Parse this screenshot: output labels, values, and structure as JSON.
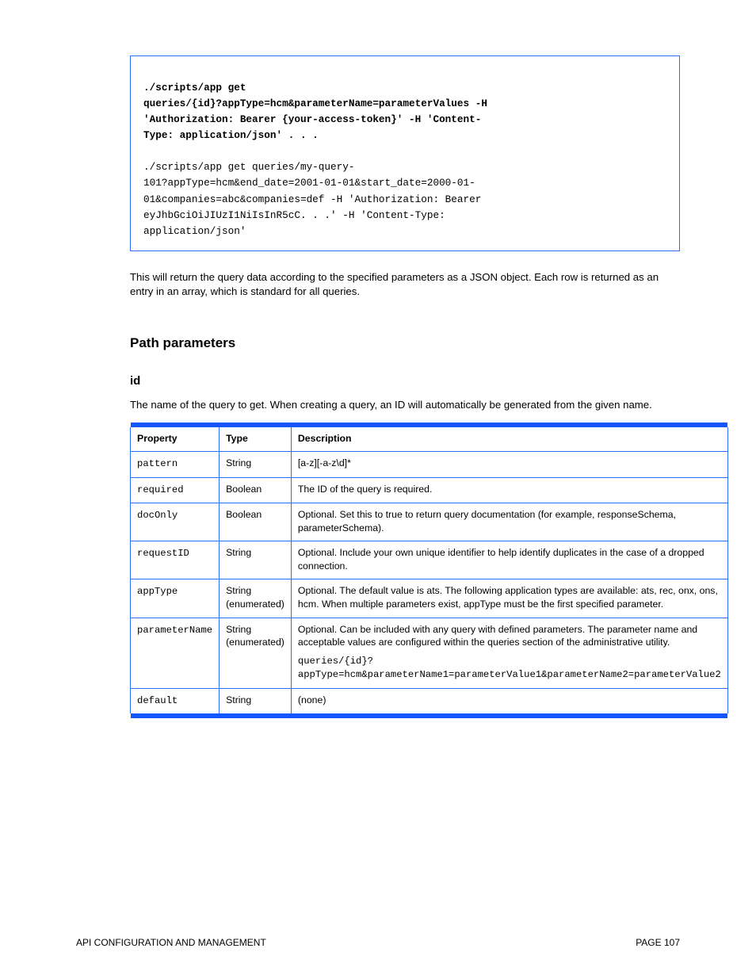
{
  "codebox": {
    "lines": [
      "",
      "./scripts/app get",
      "queries/{id}?appType=hcm&parameterName=parameterValues -H",
      "'Authorization: Bearer {your-access-token}' -H 'Content-",
      "Type: application/json' . . .",
      "",
      "./scripts/app get queries/my-query-",
      "101?appType=hcm&end_date=2001-01-01&start_date=2000-01-",
      "01&companies=abc&companies=def -H 'Authorization: Bearer",
      "eyJhbGciOiJIUzI1NiIsInR5cC. . .' -H 'Content-Type:",
      "application/json'"
    ],
    "bold_until": 4
  },
  "intro": "This will return the query data according to the specified parameters as a JSON object. Each row is returned as an entry in an array, which is standard for all queries.",
  "heading_pathparams": "Path parameters",
  "heading_field_id": "id",
  "field_id_desc": "The name of the query to get. When creating a query, an ID will automatically be generated from the given name.",
  "table": {
    "headers": [
      "Property",
      "Type",
      "Description"
    ],
    "rows": [
      [
        "pattern",
        "String",
        "[a-z][-a-z\\d]*"
      ],
      [
        "required",
        "Boolean",
        "The ID of the query is required."
      ],
      [
        "docOnly",
        "Boolean",
        "Optional. Set this to true to return query documentation (for example, responseSchema, parameterSchema)."
      ],
      [
        "requestID ",
        "String",
        "Optional. Include your own unique identifier to help identify duplicates in the case of a dropped connection."
      ],
      [
        "appType",
        "String (enumerated)",
        "Optional. The default value is ats. The following application types are available: ats, rec, onx, ons, hcm. When multiple parameters exist, appType must be the first specified parameter."
      ],
      [
        "parameterName   ",
        "String (enumerated)",
        "Optional. Can be included with any query with defined parameters. The parameter name and acceptable values are configured within the queries section of the administrative utility.\nqueries/{id}?appType=hcm&parameterName1=parameterValue1&parameterName2=parameterValue2"
      ],
      [
        "default",
        "String",
        "(none)"
      ]
    ]
  },
  "footer": {
    "left": "API CONFIGURATION AND MANAGEMENT",
    "right": "PAGE 107"
  }
}
